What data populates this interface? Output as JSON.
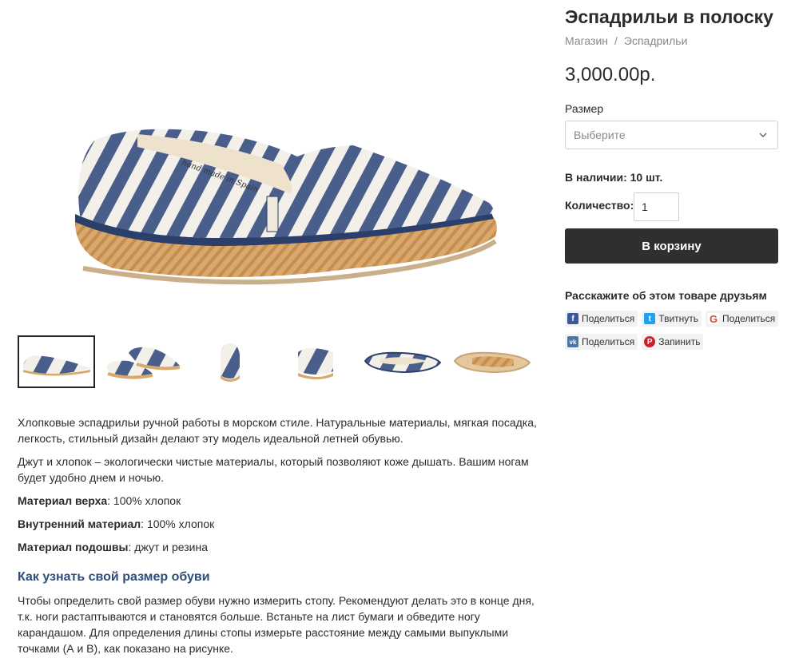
{
  "product": {
    "title": "Эспадрильи в полоску",
    "price": "3,000.00р.",
    "image_alt_text": "hand made in Spain"
  },
  "breadcrumb": {
    "shop": "Магазин",
    "separator": "/",
    "category": "Эспадрильи"
  },
  "size": {
    "label": "Размер",
    "placeholder": "Выберите"
  },
  "stock": {
    "text": "В наличии: 10 шт."
  },
  "quantity": {
    "label": "Количество:",
    "value": "1"
  },
  "cart": {
    "button_label": "В корзину"
  },
  "share": {
    "title": "Расскажите об этом товаре друзьям",
    "buttons": [
      {
        "label": "Поделиться",
        "icon": "facebook-icon",
        "color": "#3b5998"
      },
      {
        "label": "Твитнуть",
        "icon": "twitter-icon",
        "color": "#1da1f2"
      },
      {
        "label": "Поделиться",
        "icon": "google-icon",
        "color": "#dd4b39"
      },
      {
        "label": "Поделиться",
        "icon": "vk-icon",
        "color": "#4a76a8"
      },
      {
        "label": "Запинить",
        "icon": "pinterest-icon",
        "color": "#cb2027"
      }
    ]
  },
  "description": {
    "p1": "Хлопковые эспадрильи ручной работы в морском стиле. Натуральные материалы, мягкая посадка, легкость, стильный дизайн делают эту модель идеальной летней обувью.",
    "p2": "Джут и хлопок – экологически чистые материалы, который позволяют коже дышать. Вашим ногам будет удобно днем и ночью.",
    "material_top_label": "Материал верха",
    "material_top_value": ": 100% хлопок",
    "material_inner_label": "Внутренний материал",
    "material_inner_value": ": 100% хлопок",
    "material_sole_label": "Материал подошвы",
    "material_sole_value": ": джут и резина",
    "size_heading": "Как узнать свой размер обуви",
    "size_text": "Чтобы определить свой размер обуви нужно измерить стопу. Рекомендуют делать это в конце дня, т.к. ноги растаптываются и становятся больше. Встаньте на лист бумаги и обведите ногу карандашом. Для определения длины стопы измерьте расстояние между самыми выпуклыми точками (А и В), как показано на рисунке."
  },
  "colors": {
    "stripe_blue": "#4a5e8c",
    "jute": "#d9a86a",
    "button_dark": "#2f2f2f",
    "heading_blue": "#2d4d7c"
  }
}
